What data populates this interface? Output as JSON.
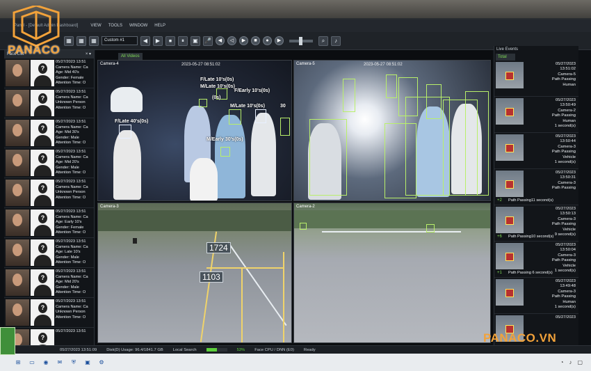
{
  "app": {
    "title": "Panel - [Default Admin Dashboard]",
    "menus": [
      "VIEW",
      "TOOLS",
      "WINDOW",
      "HELP"
    ]
  },
  "toolbar": {
    "layout_value": "Custom #1",
    "buttons": [
      "◀",
      "▶",
      "⏹",
      "⏸"
    ]
  },
  "face_list": {
    "header": "Face List",
    "items": [
      {
        "time": "05/27/2023 13:51",
        "line2": "Camera Name: Ca",
        "line3": "Age: Mid 40's",
        "line4": "Gender: Female",
        "line5": "Attention Time: O"
      },
      {
        "time": "05/27/2023 13:51",
        "line2": "Camera Name: Ca",
        "line3": "Unknown Person",
        "line4": "Attention Time: O",
        "line5": ""
      },
      {
        "time": "05/27/2023 13:51",
        "line2": "Camera Name: Ca",
        "line3": "Age: Mid 30's",
        "line4": "Gender: Male",
        "line5": "Attention Time: O"
      },
      {
        "time": "05/27/2023 13:51",
        "line2": "Camera Name: Ca",
        "line3": "Age: Mid 20's",
        "line4": "Gender: Male",
        "line5": "Attention Time: O"
      },
      {
        "time": "05/27/2023 13:51",
        "line2": "Camera Name: Ca",
        "line3": "Unknown Person",
        "line4": "Attention Time: O",
        "line5": ""
      },
      {
        "time": "05/27/2023 13:51",
        "line2": "Camera Name: Ca",
        "line3": "Age: Early 10's",
        "line4": "Gender: Female",
        "line5": "Attention Time: O"
      },
      {
        "time": "05/27/2023 13:51",
        "line2": "Camera Name: Ca",
        "line3": "Age: Late 10's",
        "line4": "Gender: Male",
        "line5": "Attention Time: O"
      },
      {
        "time": "05/27/2023 13:51",
        "line2": "Camera Name: Ca",
        "line3": "Age: Mid 20's",
        "line4": "Gender: Male",
        "line5": "Attention Time: O"
      },
      {
        "time": "05/27/2023 13:51",
        "line2": "Camera Name: Ca",
        "line3": "Unknown Person",
        "line4": "Attention Time: O",
        "line5": ""
      },
      {
        "time": "05/27/2023 13:51",
        "line2": "",
        "line3": "",
        "line4": "",
        "line5": ""
      }
    ]
  },
  "video": {
    "tab": "All Videos",
    "cameras": {
      "cam4": {
        "label": "Camera-4",
        "timestamp": "2023-05-27 08:51:02"
      },
      "cam5": {
        "label": "Camera-5",
        "timestamp": "2023-05-27 08:51:02"
      },
      "cam3": {
        "label": "Camera-3",
        "timestamp": ""
      },
      "cam2": {
        "label": "Camera-2",
        "timestamp": ""
      }
    },
    "tags": {
      "t1": "F/Late 10's(0s)",
      "t2": "M/Late 10's(0s)",
      "t3": "F/Early 10's(0s)",
      "t4": "F/Late 40's(0s)",
      "t5": "M/Early 30's(0s)",
      "t6": "M/Late 10's(0s)",
      "t7": "(0s)",
      "t8": "30"
    },
    "counters": {
      "c1": "1724",
      "c2": "1103"
    }
  },
  "live_events": {
    "header": "Live Events",
    "tab": "Total",
    "items": [
      {
        "date": "05/27/2023",
        "time": "13:51:02",
        "camera": "Camera-5",
        "event": "Path Passing",
        "type": "Human",
        "duration": "",
        "badge": "",
        "foot": ""
      },
      {
        "date": "05/27/2023",
        "time": "13:50:49",
        "camera": "Camera-2",
        "event": "Path Passing",
        "type": "Human",
        "duration": "1 second(s)",
        "badge": "",
        "foot": ""
      },
      {
        "date": "05/27/2023",
        "time": "13:50:44",
        "camera": "Camera-3",
        "event": "Path Passing",
        "type": "Vehicle",
        "duration": "1 second(s)",
        "badge": "",
        "foot": ""
      },
      {
        "date": "05/27/2023",
        "time": "13:50:31",
        "camera": "Camera-3",
        "event": "Path Passing",
        "type": "",
        "duration": "",
        "badge": "+2",
        "foot": "Path Passing11 second(s)"
      },
      {
        "date": "05/27/2023",
        "time": "13:50:13",
        "camera": "Camera-3",
        "event": "Path Passing",
        "type": "Vehicle",
        "duration": "9 second(s)",
        "badge": "+6",
        "foot": "Path Passing10 second(s)"
      },
      {
        "date": "05/27/2023",
        "time": "13:50:04",
        "camera": "Camera-3",
        "event": "Path Passing",
        "type": "Vehicle",
        "duration": "1 second(s)",
        "badge": "+1",
        "foot": "Path Passing 6 second(s)"
      },
      {
        "date": "05/27/2023",
        "time": "13:49:48",
        "camera": "Camera-3",
        "event": "Path Passing",
        "type": "Human",
        "duration": "1 second(s)",
        "badge": "",
        "foot": ""
      },
      {
        "date": "05/27/2023",
        "time": "",
        "camera": "",
        "event": "",
        "type": "",
        "duration": "",
        "badge": "",
        "foot": ""
      }
    ]
  },
  "status": {
    "datetime": "05/27/2023 13:51:09",
    "disk": "Disk(D) Usage: 96.4/1841.7 GB",
    "search": "Local Search",
    "progress_pct": 53,
    "progress_label": "53%",
    "cpu": "Face CPU / DNN (E0)",
    "ready": "Ready"
  },
  "branding": {
    "logo_text": "PANACO",
    "watermark": "PANACO.VN"
  },
  "colors": {
    "accent": "#7fdc54",
    "brand": "#f2a23a",
    "detect": "#b9f06a"
  }
}
